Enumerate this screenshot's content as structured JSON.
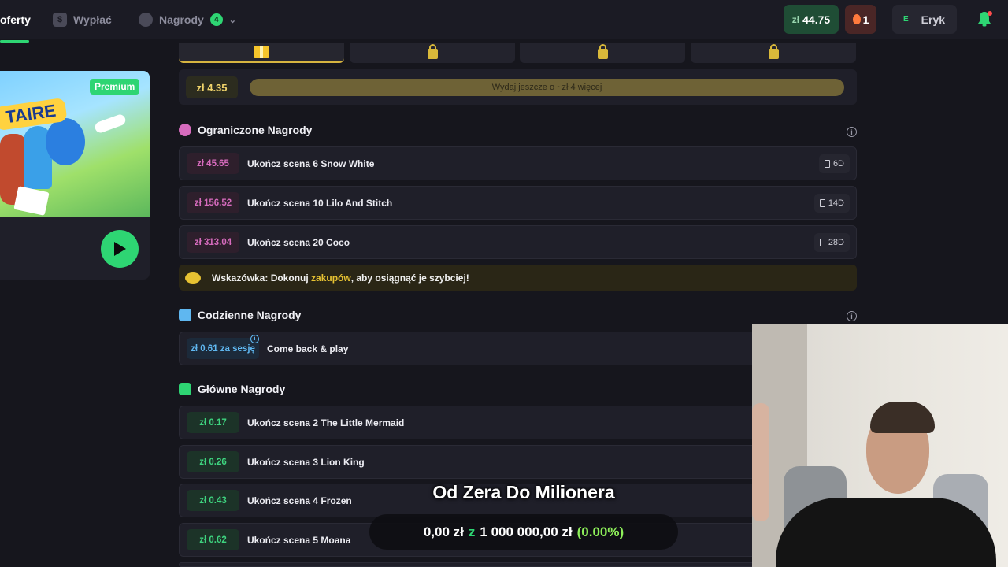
{
  "nav": {
    "items": [
      {
        "label": "oferty",
        "active": true
      },
      {
        "label": "Wypłać",
        "active": false
      },
      {
        "label": "Nagrody",
        "active": false,
        "badge": "4"
      }
    ]
  },
  "header": {
    "balance_currency": "zł",
    "balance_value": "44.75",
    "streak": "1",
    "user_initial": "E",
    "user_name": "Eryk"
  },
  "game_card": {
    "title_art": "TAIRE",
    "premium": "Premium"
  },
  "progress": {
    "amount": "zł 4.35",
    "bar_text": "Wydaj jeszcze o ~zł 4 więcej"
  },
  "limited": {
    "title": "Ograniczone Nagrody",
    "items": [
      {
        "amount": "zł 45.65",
        "task": "Ukończ scena 6 Snow White",
        "timer": "6D"
      },
      {
        "amount": "zł 156.52",
        "task": "Ukończ scena 10 Lilo And Stitch",
        "timer": "14D"
      },
      {
        "amount": "zł 313.04",
        "task": "Ukończ scena 20 Coco",
        "timer": "28D"
      }
    ]
  },
  "tip": {
    "prefix": "Wskazówka: Dokonuj",
    "highlight": "zakupów",
    "suffix": ", aby osiągnąć je szybciej!"
  },
  "daily": {
    "title": "Codzienne Nagrody",
    "amount": "zł 0.61 za sesję",
    "task": "Come back & play"
  },
  "main_rewards": {
    "title": "Główne Nagrody",
    "items": [
      {
        "amount": "zł 0.17",
        "task": "Ukończ scena 2 The Little Mermaid"
      },
      {
        "amount": "zł 0.26",
        "task": "Ukończ scena 3 Lion King"
      },
      {
        "amount": "zł 0.43",
        "task": "Ukończ scena 4 Frozen"
      },
      {
        "amount": "zł 0.62",
        "task": "Ukończ scena 5 Moana"
      }
    ]
  },
  "overlay": {
    "title": "Od Zera Do Milionera",
    "current": "0,00 zł",
    "sep": "z",
    "target": "1 000 000,00 zł",
    "percent": "(0.00%)"
  },
  "colors": {
    "accent_green": "#2ed573",
    "accent_pink": "#d66bbd",
    "accent_gold": "#e7c232"
  }
}
